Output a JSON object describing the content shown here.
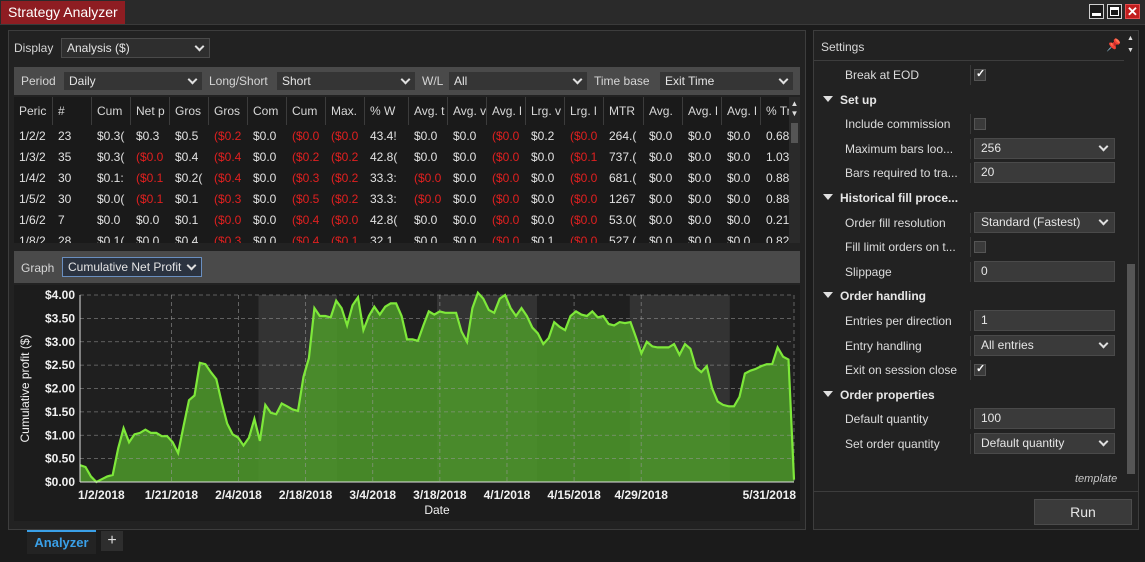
{
  "window": {
    "title": "Strategy Analyzer"
  },
  "display": {
    "label": "Display",
    "value": "Analysis ($)"
  },
  "filters": {
    "period_label": "Period",
    "period_value": "Daily",
    "longshort_label": "Long/Short",
    "longshort_value": "Short",
    "wl_label": "W/L",
    "wl_value": "All",
    "timebase_label": "Time base",
    "timebase_value": "Exit Time"
  },
  "table": {
    "columns": [
      "Peric",
      "#",
      "Cum",
      "Net p",
      "Gros",
      "Gros",
      "Com",
      "Cum",
      "Max.",
      "% W",
      "Avg. t",
      "Avg. v",
      "Avg. l",
      "Lrg. v",
      "Lrg. l",
      "MTR",
      "Avg.",
      "Avg. l",
      "Avg. l",
      "% Tra"
    ],
    "rows": [
      [
        "1/2/2",
        "23",
        "$0.3(",
        "$0.3",
        "$0.5",
        "($0.2",
        "$0.0",
        "($0.0",
        "($0.0",
        "43.4!",
        "$0.0",
        "$0.0",
        "($0.0",
        "$0.2",
        "($0.0",
        "264.(",
        "$0.0",
        "$0.0",
        "$0.0",
        "0.68"
      ],
      [
        "1/3/2",
        "35",
        "$0.3(",
        "($0.0",
        "$0.4",
        "($0.4",
        "$0.0",
        "($0.2",
        "($0.2",
        "42.8(",
        "$0.0",
        "$0.0",
        "($0.0",
        "$0.0",
        "($0.1",
        "737.(",
        "$0.0",
        "$0.0",
        "$0.0",
        "1.03"
      ],
      [
        "1/4/2",
        "30",
        "$0.1:",
        "($0.1",
        "$0.2(",
        "($0.4",
        "$0.0",
        "($0.3",
        "($0.2",
        "33.3:",
        "($0.0",
        "$0.0",
        "($0.0",
        "$0.0",
        "($0.0",
        "681.(",
        "$0.0",
        "$0.0",
        "$0.0",
        "0.88"
      ],
      [
        "1/5/2",
        "30",
        "$0.0(",
        "($0.1",
        "$0.1",
        "($0.3",
        "$0.0",
        "($0.5",
        "($0.2",
        "33.3:",
        "($0.0",
        "$0.0",
        "($0.0",
        "$0.0",
        "($0.0",
        "1267",
        "$0.0",
        "$0.0",
        "$0.0",
        "0.88"
      ],
      [
        "1/6/2",
        "7",
        "$0.0",
        "$0.0",
        "$0.1",
        "($0.0",
        "$0.0",
        "($0.4",
        "($0.0",
        "42.8(",
        "$0.0",
        "$0.0",
        "($0.0",
        "$0.0",
        "($0.0",
        "53.0(",
        "$0.0",
        "$0.0",
        "$0.0",
        "0.21"
      ],
      [
        "1/8/2",
        "28",
        "$0.1(",
        "$0.0",
        "$0.4",
        "($0.3",
        "$0.0",
        "($0.4",
        "($0.1",
        "32.1",
        "$0.0",
        "$0.0",
        "($0.0",
        "$0.1",
        "($0.0",
        "527.(",
        "$0.0",
        "$0.0",
        "$0.0",
        "0.82"
      ]
    ]
  },
  "graph": {
    "label": "Graph",
    "value": "Cumulative Net Profit"
  },
  "chart_data": {
    "type": "area",
    "xlabel": "Date",
    "ylabel": "Cumulative profit ($)",
    "ylim": [
      0,
      4
    ],
    "yticks": [
      "$0.00",
      "$0.50",
      "$1.00",
      "$1.50",
      "$2.00",
      "$2.50",
      "$3.00",
      "$3.50",
      "$4.00"
    ],
    "xticks": [
      "1/2/2018",
      "1/21/2018",
      "2/4/2018",
      "2/18/2018",
      "3/4/2018",
      "3/18/2018",
      "4/1/2018",
      "4/15/2018",
      "4/29/2018",
      "5/31/2018"
    ],
    "grid": true,
    "fill_color": "#4e9a2a",
    "line_color": "#7ee83a",
    "values": [
      0.36,
      0.32,
      0.12,
      0.0,
      0.06,
      0.12,
      0.15,
      0.72,
      1.15,
      0.85,
      1.02,
      1.05,
      1.12,
      1.05,
      1.05,
      0.98,
      0.98,
      0.85,
      0.62,
      1.2,
      1.75,
      1.85,
      2.55,
      2.52,
      2.35,
      2.2,
      1.7,
      1.25,
      1.02,
      0.95,
      0.78,
      0.95,
      1.35,
      0.88,
      1.65,
      1.48,
      1.45,
      1.68,
      1.62,
      1.55,
      1.52,
      2.25,
      2.65,
      3.72,
      3.55,
      3.55,
      3.52,
      3.88,
      3.72,
      3.35,
      3.78,
      3.95,
      3.25,
      3.55,
      3.75,
      3.58,
      3.75,
      3.82,
      3.82,
      3.55,
      3.05,
      3.05,
      3.02,
      3.35,
      3.65,
      3.58,
      3.65,
      3.62,
      3.62,
      3.62,
      3.22,
      3.0,
      3.72,
      4.05,
      3.92,
      3.68,
      3.62,
      3.92,
      4.0,
      3.72,
      3.55,
      3.72,
      3.55,
      3.3,
      3.18,
      2.95,
      3.08,
      3.42,
      3.32,
      3.25,
      3.55,
      3.65,
      3.58,
      3.55,
      3.65,
      3.52,
      3.55,
      3.38,
      3.35,
      3.42,
      3.4,
      3.42,
      3.1,
      2.75,
      3.0,
      2.9,
      2.88,
      2.88,
      2.88,
      2.95,
      2.72,
      2.95,
      2.85,
      2.45,
      2.35,
      2.48,
      2.0,
      1.72,
      1.65,
      1.62,
      1.62,
      1.82,
      2.32,
      2.38,
      2.42,
      2.48,
      2.52,
      2.52,
      2.88,
      2.68,
      2.62,
      0.05
    ],
    "shaded_bands": [
      [
        0.25,
        0.36
      ],
      [
        0.5,
        0.64
      ],
      [
        0.77,
        0.91
      ]
    ]
  },
  "tabs": {
    "active": "Analyzer",
    "add": "+"
  },
  "settings": {
    "title": "Settings",
    "template_label": "template",
    "run_label": "Run",
    "rows": [
      {
        "kind": "prop",
        "name": "Break at EOD",
        "type": "check",
        "checked": true
      },
      {
        "kind": "cat",
        "name": "Set up"
      },
      {
        "kind": "prop",
        "name": "Include commission",
        "type": "check",
        "checked": false
      },
      {
        "kind": "prop",
        "name": "Maximum bars loo...",
        "type": "select",
        "value": "256"
      },
      {
        "kind": "prop",
        "name": "Bars required to tra...",
        "type": "input",
        "value": "20"
      },
      {
        "kind": "cat",
        "name": "Historical fill proce..."
      },
      {
        "kind": "prop",
        "name": "Order fill resolution",
        "type": "select",
        "value": "Standard (Fastest)"
      },
      {
        "kind": "prop",
        "name": "Fill limit orders on t...",
        "type": "check",
        "checked": false
      },
      {
        "kind": "prop",
        "name": "Slippage",
        "type": "input",
        "value": "0"
      },
      {
        "kind": "cat",
        "name": "Order handling"
      },
      {
        "kind": "prop",
        "name": "Entries per direction",
        "type": "input",
        "value": "1"
      },
      {
        "kind": "prop",
        "name": "Entry handling",
        "type": "select",
        "value": "All entries"
      },
      {
        "kind": "prop",
        "name": "Exit on session close",
        "type": "check",
        "checked": true
      },
      {
        "kind": "cat",
        "name": "Order properties"
      },
      {
        "kind": "prop",
        "name": "Default quantity",
        "type": "input",
        "value": "100"
      },
      {
        "kind": "prop",
        "name": "Set order quantity",
        "type": "select",
        "value": "Default quantity"
      }
    ]
  }
}
